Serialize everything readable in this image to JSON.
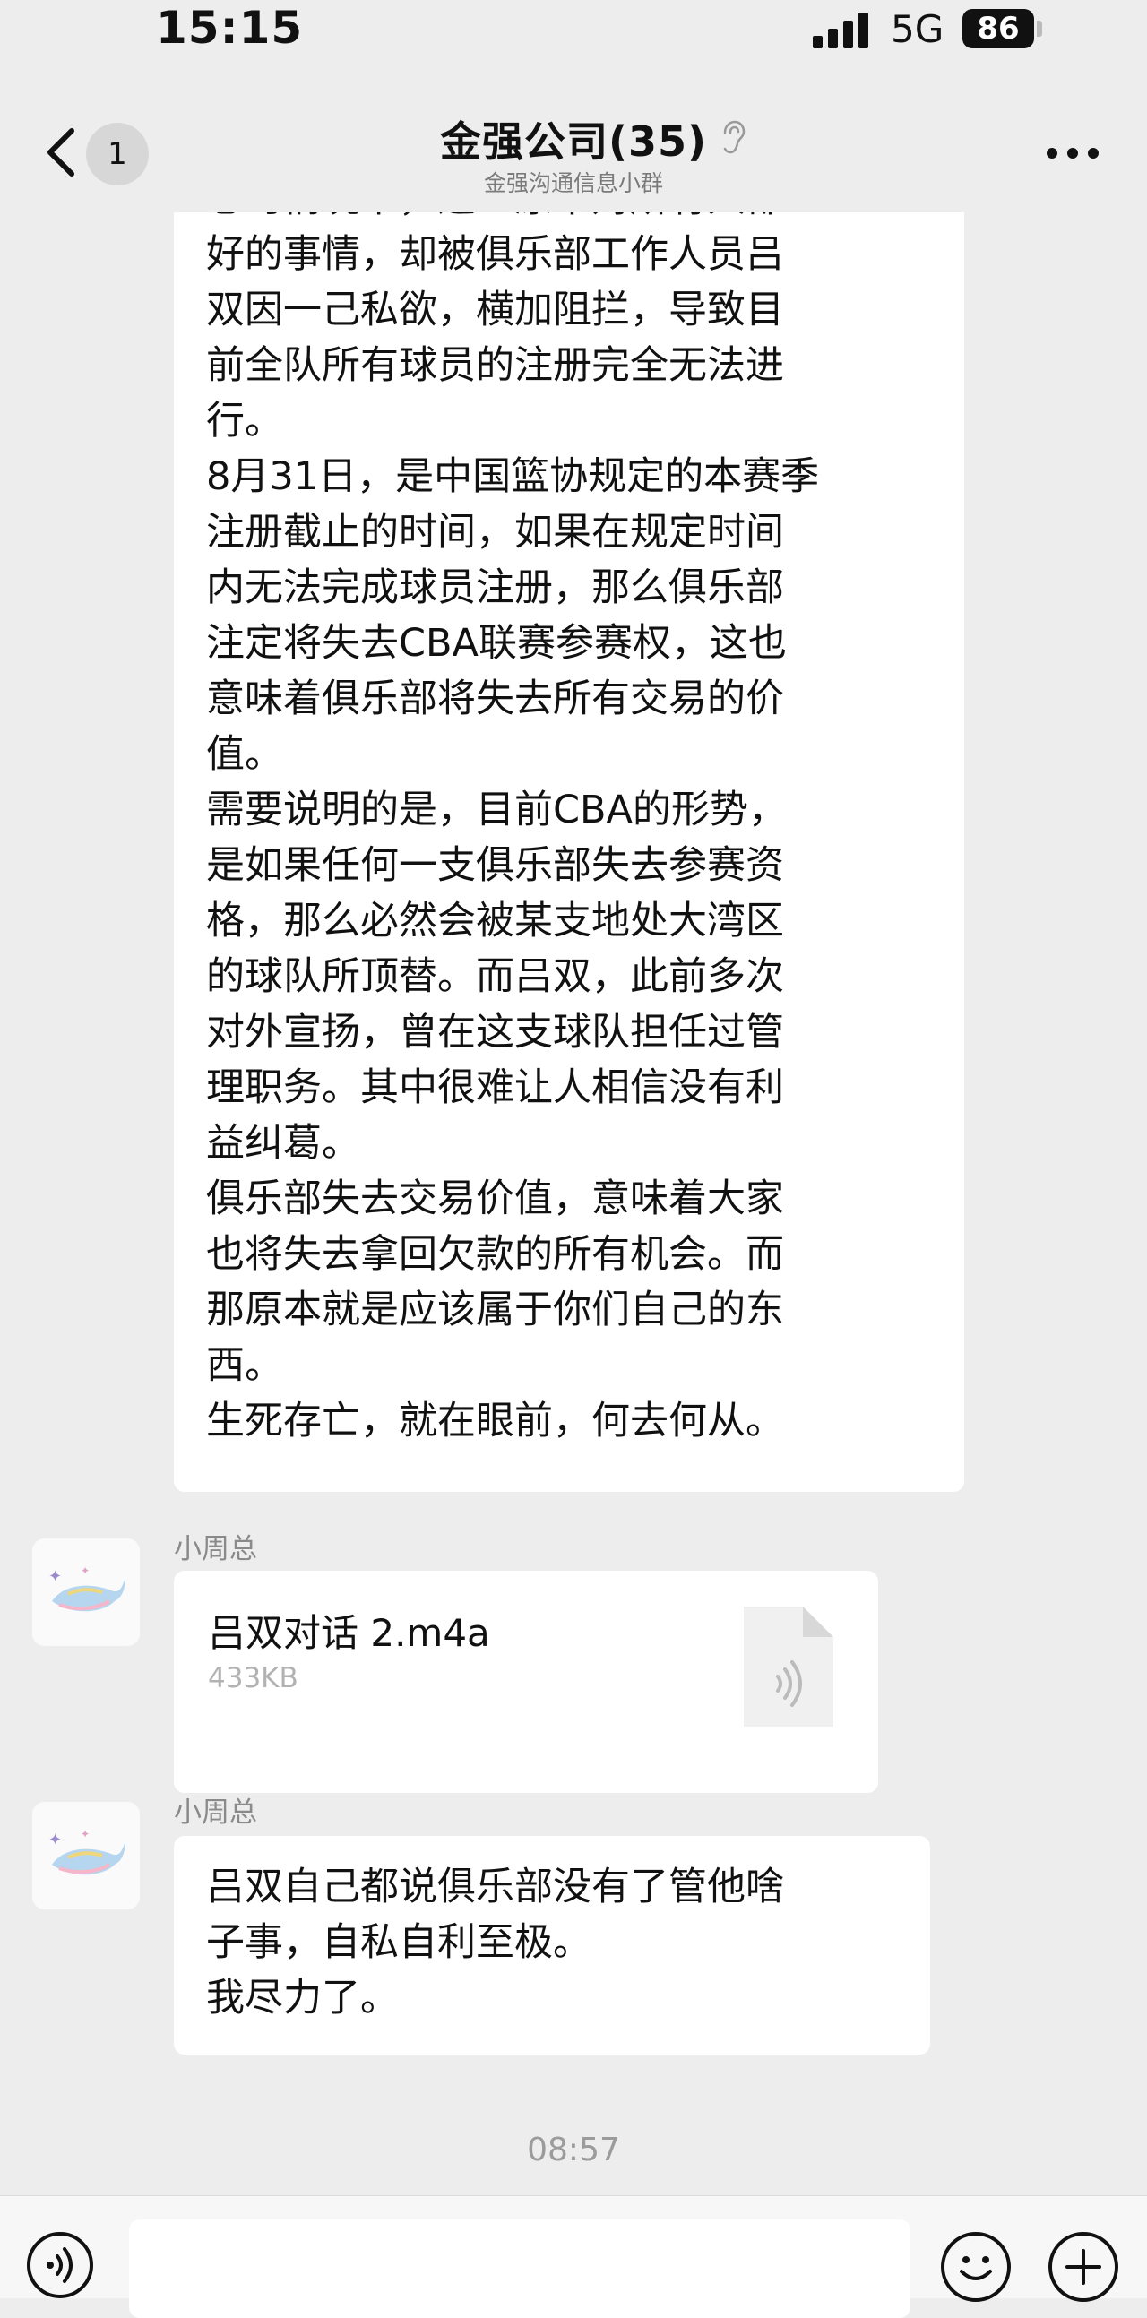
{
  "status_bar": {
    "time": "15:15",
    "network": "5G",
    "battery": "86"
  },
  "header": {
    "back_badge": "1",
    "title": "金强公司(35)",
    "subtitle": "金强沟通信息小群"
  },
  "messages": [
    {
      "type": "text",
      "cropped_top_text": "息时情况下，这一原本对所有人都",
      "text": "好的事情，却被俱乐部工作人员吕\n双因一己私欲，横加阻拦，导致目\n前全队所有球员的注册完全无法进\n行。\n8月31日，是中国篮协规定的本赛季\n注册截止的时间，如果在规定时间\n内无法完成球员注册，那么俱乐部\n注定将失去CBA联赛参赛权，这也\n意味着俱乐部将失去所有交易的价\n值。\n需要说明的是，目前CBA的形势，\n是如果任何一支俱乐部失去参赛资\n格，那么必然会被某支地处大湾区\n的球队所顶替。而吕双，此前多次\n对外宣扬，曾在这支球队担任过管\n理职务。其中很难让人相信没有利\n益纠葛。\n俱乐部失去交易价值，意味着大家\n也将失去拿回欠款的所有机会。而\n那原本就是应该属于你们自己的东\n西。\n生死存亡，就在眼前，何去何从。"
    },
    {
      "type": "file",
      "sender": "小周总",
      "file_name": "吕双对话 2.m4a",
      "file_size": "433KB"
    },
    {
      "type": "text",
      "sender": "小周总",
      "text": "吕双自己都说俱乐部没有了管他啥\n子事，自私自利至极。\n我尽力了。"
    }
  ],
  "timestamp": "08:57",
  "icons": {
    "back": "chevron-left-icon",
    "mute": "ear-mute-icon",
    "more": "more-dots-icon",
    "voice": "voice-wave-icon",
    "emoji": "emoji-smile-icon",
    "plus": "plus-circle-icon",
    "file": "audio-file-icon"
  },
  "colors": {
    "background": "#ededed",
    "bubble": "#ffffff",
    "badge": "#d7d7d7",
    "muted_text": "#8a8a8a"
  }
}
